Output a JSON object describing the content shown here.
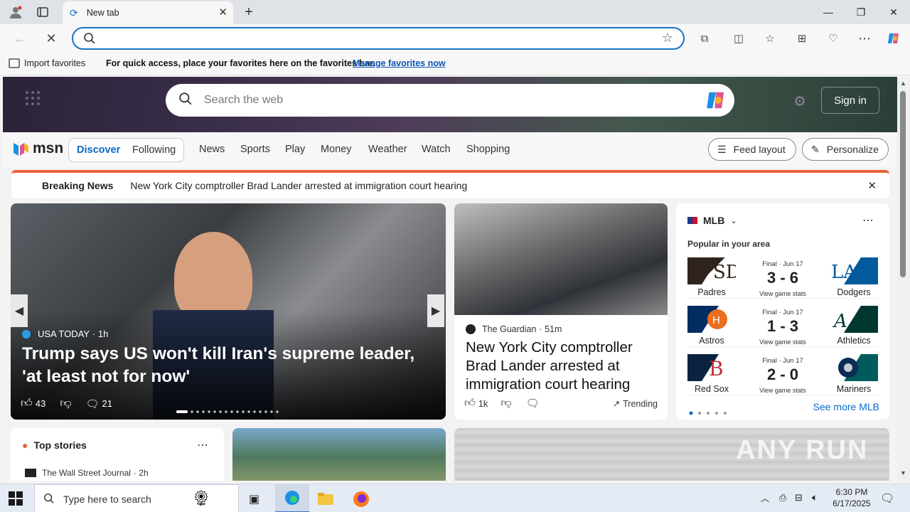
{
  "browser": {
    "tab_title": "New tab",
    "address_value": "",
    "favbar": {
      "import_label": "Import favorites",
      "message": "For quick access, place your favorites here on the favorites bar.",
      "manage_link": "Manage favorites now"
    }
  },
  "msn": {
    "search_placeholder": "Search the web",
    "sign_in": "Sign in",
    "logo_text": "msn",
    "tabs": [
      "Discover",
      "Following"
    ],
    "nav": [
      "News",
      "Sports",
      "Play",
      "Money",
      "Weather",
      "Watch",
      "Shopping"
    ],
    "feed_layout": "Feed layout",
    "personalize": "Personalize",
    "breaking": {
      "label": "Breaking News",
      "headline": "New York City comptroller Brad Lander arrested at immigration court hearing"
    },
    "hero_story": {
      "source": "USA TODAY",
      "age": "· 1h",
      "headline": "Trump says US won't kill Iran's supreme leader, 'at least not for now'",
      "likes": "43",
      "comments": "21"
    },
    "second_story": {
      "source": "The Guardian",
      "age": "· 51m",
      "headline": "New York City comptroller Brad Lander arrested at immigration court hearing",
      "likes": "1k",
      "trending": "Trending"
    },
    "mlb": {
      "title": "MLB",
      "subtitle": "Popular in your area",
      "see_more": "See more MLB",
      "games": [
        {
          "status": "Final · Jun 17",
          "score": "3 - 6",
          "left": "Padres",
          "right": "Dodgers",
          "link": "View game stats",
          "left_color": "#2f241d",
          "right_color": "#005a9c"
        },
        {
          "status": "Final · Jun 17",
          "score": "1 - 3",
          "left": "Astros",
          "right": "Athletics",
          "link": "View game stats",
          "left_color": "#002d62",
          "right_color": "#003831"
        },
        {
          "status": "Final · Jun 17",
          "score": "2 - 0",
          "left": "Red Sox",
          "right": "Mariners",
          "link": "View game stats",
          "left_color": "#0c2340",
          "right_color": "#005c5c"
        }
      ]
    },
    "top_stories": {
      "title": "Top stories",
      "first_source": "The Wall Street Journal",
      "first_age": "· 2h"
    }
  },
  "taskbar": {
    "search_placeholder": "Type here to search",
    "time": "6:30 PM",
    "date": "6/17/2025"
  },
  "watermark": "ANY RUN"
}
